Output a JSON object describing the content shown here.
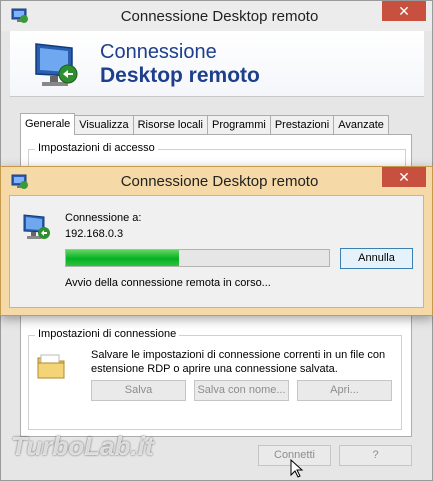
{
  "main_window": {
    "title": "Connessione Desktop remoto",
    "close_glyph": "✕",
    "banner_line1": "Connessione",
    "banner_line2": "Desktop remoto",
    "tabs": [
      {
        "label": "Generale",
        "active": true
      },
      {
        "label": "Visualizza"
      },
      {
        "label": "Risorse locali"
      },
      {
        "label": "Programmi"
      },
      {
        "label": "Prestazioni"
      },
      {
        "label": "Avanzate"
      }
    ],
    "access_group_label": "Impostazioni di accesso",
    "connection_group_label": "Impostazioni di connessione",
    "connection_desc": "Salvare le impostazioni di connessione correnti in un file con estensione RDP o aprire una connessione salvata.",
    "save_button": "Salva",
    "save_as_button": "Salva con nome...",
    "open_button": "Apri...",
    "connect_button": "Connetti",
    "help_button": "?"
  },
  "dialog": {
    "title": "Connessione Desktop remoto",
    "close_glyph": "✕",
    "connection_label": "Connessione a:",
    "host": "192.168.0.3",
    "progress_percent": 43,
    "cancel_button": "Annulla",
    "status": "Avvio della connessione remota in corso..."
  },
  "watermark": "TurboLab.it",
  "icons": {
    "app": "remote-desktop-icon",
    "folder": "folder-icon",
    "close": "close-icon",
    "cursor": "mouse-cursor-icon"
  },
  "colors": {
    "banner_text": "#1e3f8c",
    "dialog_frame": "#f5d9a6",
    "close_button": "#c7503e",
    "progress": "#06b025"
  }
}
